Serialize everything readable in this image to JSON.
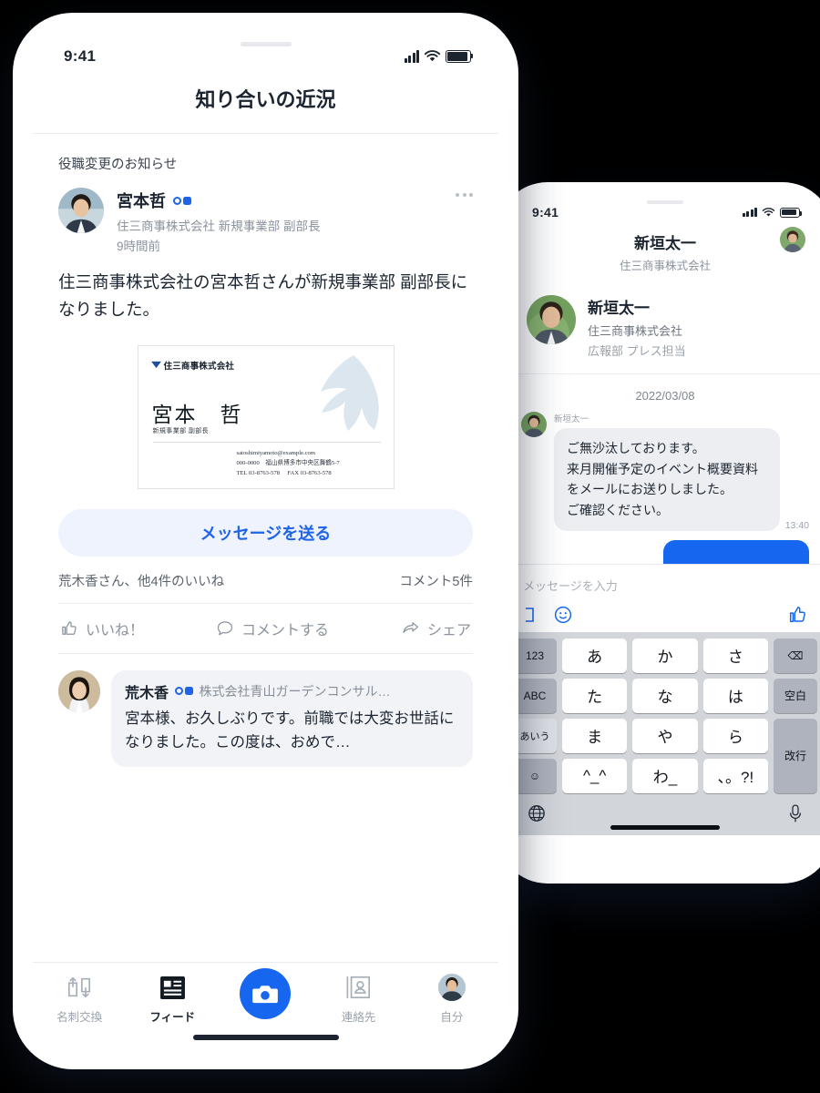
{
  "left_phone": {
    "status": {
      "time": "9:41"
    },
    "nav_title": "知り合いの近況",
    "post": {
      "kicker": "役職変更のお知らせ",
      "author_name": "宮本哲",
      "author_org": "住三商事株式会社 新規事業部 副部長",
      "timestamp": "9時間前",
      "body": "住三商事株式会社の宮本哲さんが新規事業部 副部長になりました。",
      "business_card": {
        "company": "住三商事株式会社",
        "name": "宮本　哲",
        "title": "新規事業部 副部長",
        "email": "satoshimiyamoto@example.com",
        "address": "000-0000　福山県博多市中央区舞鶴5-7",
        "tel": "TEL  03-8763-578",
        "fax": "FAX  03-8763-578"
      },
      "message_button": "メッセージを送る",
      "likes_text": "荒木香さん、他4件のいいね",
      "comments_text": "コメント5件",
      "actions": [
        {
          "label": "いいね！",
          "icon": "thumbs-up-icon"
        },
        {
          "label": "コメントする",
          "icon": "comment-icon"
        },
        {
          "label": "シェア",
          "icon": "share-icon"
        }
      ],
      "comment": {
        "name": "荒木香",
        "org": "株式会社青山ガーデンコンサル…",
        "text": "宮本様、お久しぶりです。前職では大変お世話になりました。この度は、おめで…"
      }
    },
    "tabs": [
      {
        "label": "名刺交換",
        "icon": "card-exchange-icon",
        "active": false
      },
      {
        "label": "フィード",
        "icon": "feed-icon",
        "active": true
      },
      {
        "label": "",
        "icon": "camera-icon",
        "active": false
      },
      {
        "label": "連絡先",
        "icon": "contacts-icon",
        "active": false
      },
      {
        "label": "自分",
        "icon": "profile-avatar-icon",
        "active": false
      }
    ]
  },
  "right_phone": {
    "status": {
      "time": "9:41"
    },
    "nav": {
      "title": "新垣太一",
      "subtitle": "住三商事株式会社"
    },
    "profile": {
      "name": "新垣太一",
      "company": "住三商事株式会社",
      "department": "広報部 プレス担当"
    },
    "chat": {
      "date": "2022/03/08",
      "sender_name": "新垣太一",
      "message": "ご無沙汰しております。\n来月開催予定のイベント概要資料をメールにお送りしました。\nご確認ください。",
      "time": "13:40"
    },
    "input": {
      "placeholder": "メッセージを入力"
    },
    "keyboard": {
      "rows": [
        [
          {
            "l": "123",
            "t": "fn"
          },
          {
            "l": "あ",
            "t": "key"
          },
          {
            "l": "か",
            "t": "key"
          },
          {
            "l": "さ",
            "t": "key"
          },
          {
            "l": "⌫",
            "t": "fn"
          }
        ],
        [
          {
            "l": "ABC",
            "t": "fn"
          },
          {
            "l": "た",
            "t": "key"
          },
          {
            "l": "な",
            "t": "key"
          },
          {
            "l": "は",
            "t": "key"
          },
          {
            "l": "空白",
            "t": "fn"
          }
        ],
        [
          {
            "l": "あいう",
            "t": "lt"
          },
          {
            "l": "ま",
            "t": "key"
          },
          {
            "l": "や",
            "t": "key"
          },
          {
            "l": "ら",
            "t": "key"
          },
          {
            "l": "改行",
            "t": "fn tall"
          }
        ],
        [
          {
            "l": "☺",
            "t": "fn"
          },
          {
            "l": "^_^",
            "t": "key"
          },
          {
            "l": "わ_",
            "t": "key"
          },
          {
            "l": "、。?!",
            "t": "key"
          }
        ]
      ]
    }
  },
  "colors": {
    "accent_blue": "#1666f0",
    "link_blue": "#1f63e8",
    "msg_btn_bg": "#eef3fd",
    "bubble_gray": "#eceef1",
    "text_dark": "#1b2430",
    "text_muted": "#8b939e",
    "keyboard_bg": "#d2d5da"
  }
}
